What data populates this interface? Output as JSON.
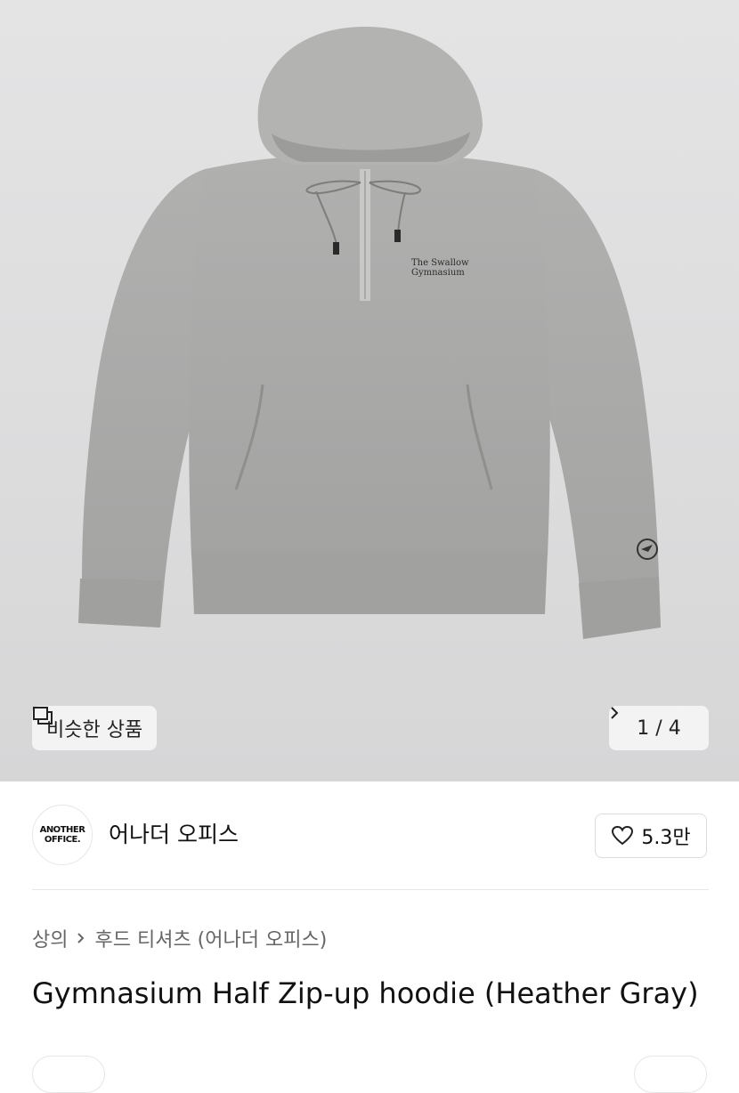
{
  "gallery": {
    "similar_label": "비슷한 상품",
    "counter": "1 / 4",
    "embroidery_line1": "The Swallow",
    "embroidery_line2": "Gymnasium"
  },
  "brand": {
    "logo_line1": "ANOTHER",
    "logo_line2": "OFFICE.",
    "name": "어나더 오피스",
    "likes": "5.3만"
  },
  "breadcrumb": {
    "category": "상의",
    "subcategory": "후드 티셔츠 (어나더 오피스)"
  },
  "product": {
    "title": "Gymnasium Half Zip-up hoodie (Heather Gray)"
  },
  "colors": {
    "hoodie": "#a9a9a8",
    "background": "#dedede",
    "chip_bg": "#f3f3f3"
  }
}
